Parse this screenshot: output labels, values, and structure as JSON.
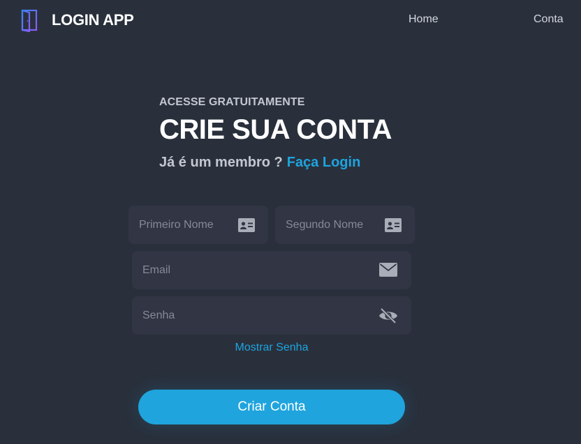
{
  "colors": {
    "background": "#29303c",
    "field_background": "#323543",
    "accent": "#1ea4df",
    "muted_text": "#c3c7d0",
    "placeholder": "#868a96",
    "icon": "#a9adb7"
  },
  "navbar": {
    "brand": "LOGIN APP",
    "logo_icon": "door-icon",
    "links": [
      "Home",
      "Conta"
    ]
  },
  "header": {
    "eyebrow": "ACESSE GRATUITAMENTE",
    "title": "CRIE SUA CONTA",
    "member_text": "Já é um membro ?",
    "login_link": "Faça Login"
  },
  "form": {
    "first_name": {
      "placeholder": "Primeiro Nome",
      "value": "",
      "icon": "id-card-icon"
    },
    "last_name": {
      "placeholder": "Segundo Nome",
      "value": "",
      "icon": "id-card-icon"
    },
    "email": {
      "placeholder": "Email",
      "value": "",
      "icon": "envelope-icon"
    },
    "password": {
      "placeholder": "Senha",
      "value": "",
      "icon": "eye-slash-icon"
    },
    "show_password": "Mostrar Senha",
    "submit": "Criar Conta"
  }
}
